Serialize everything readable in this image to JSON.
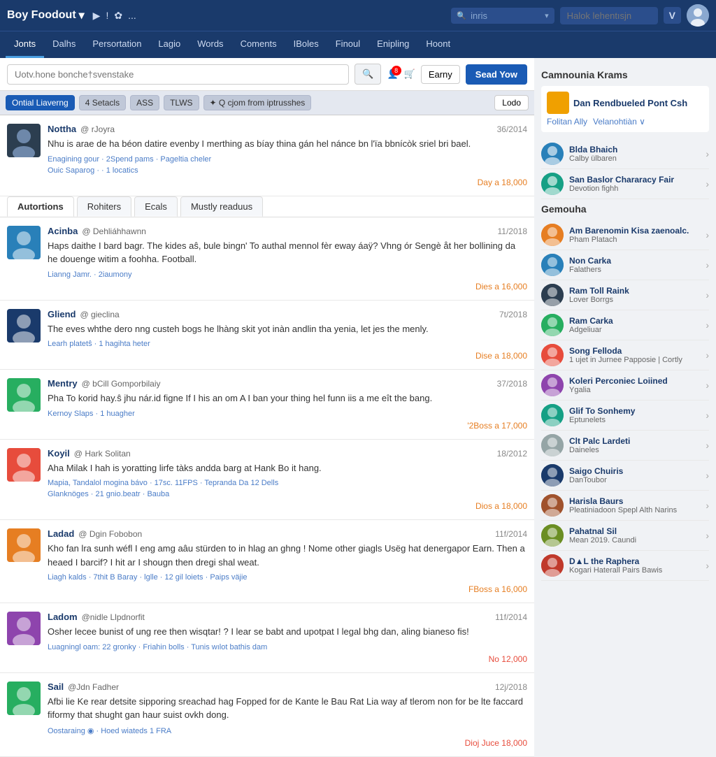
{
  "brand": {
    "name": "Boy Foodout",
    "dropdown_arrow": "▾",
    "icons": [
      "▶",
      "!",
      "✿",
      "..."
    ]
  },
  "top_nav": {
    "search_placeholder": "inris",
    "search_dropdown": "▾",
    "login_placeholder": "Halok lehentısjn",
    "v_btn": "V",
    "send_yow": "Sead Yow"
  },
  "sec_nav": {
    "items": [
      {
        "label": "Jonts",
        "active": true
      },
      {
        "label": "Dalhs",
        "active": false
      },
      {
        "label": "Persortation",
        "active": false
      },
      {
        "label": "Lagio",
        "active": false
      },
      {
        "label": "Words",
        "active": false
      },
      {
        "label": "Coments",
        "active": false
      },
      {
        "label": "IBoles",
        "active": false
      },
      {
        "label": "Finoul",
        "active": false
      },
      {
        "label": "Enipling",
        "active": false
      },
      {
        "label": "Hoont",
        "active": false
      }
    ]
  },
  "search_bar": {
    "placeholder": "Uotv.hone bonche†svenstake",
    "search_icon": "🔍",
    "notif_badge": "8",
    "earny_label": "Earny",
    "send_yow_label": "Sead Yow"
  },
  "filter_bar": {
    "active_tag": "Ontial Liaverng",
    "tags": [
      "4 Setacls",
      "ASS",
      "TLWS",
      "✦ Q cjom from iptrusshes"
    ],
    "lodo": "Lodo"
  },
  "post_tabs": {
    "tabs": [
      {
        "label": "Autortions",
        "active": true
      },
      {
        "label": "Rohiters",
        "active": false
      },
      {
        "label": "Ecals",
        "active": false
      },
      {
        "label": "Mustly readuus",
        "active": false
      }
    ]
  },
  "posts": [
    {
      "name": "Nottha",
      "handle": "@ rJoyra",
      "date": "36/2014",
      "text": "Nhu is arae de ha béon datire evenby I merthing as bíay thina gán hel nánce bn l'ïa bbnícòk sriel bri bael.",
      "meta1": "Enagining gour · 2Spend pams · Pageltia cheler",
      "meta2": "Ouic Saparog · · 1 locatics",
      "footer": "Day a 18,000",
      "footer_color": "orange"
    },
    {
      "name": "Acinba",
      "handle": "@ Dehliáhhawnn",
      "date": "11/2018",
      "text": "Haps daithe I bard bagr. The kides aŝ, bule bingn' To authal mennol fèr eway áaÿ? Vhng ór Sengè åt her bollining da he douenge witim a foohha. Football.",
      "meta1": "Lianng Jamr. · 2iaumony",
      "footer": "Dies a 16,000",
      "footer_color": "orange"
    },
    {
      "name": "Gliend",
      "handle": "@ gieclina",
      "date": "7t/2018",
      "text": "The eves whthe dero nng custeh bogs he lhàng skit yot inàn andlin tha yenia, let jes the menly.",
      "meta1": "Learh platetŝ · 1 hagihta heter",
      "footer": "Dise a 18,000",
      "footer_color": "orange"
    },
    {
      "name": "Mentry",
      "handle": "@ bCill Gomporbilaiy",
      "date": "37/2018",
      "text": "Pha To korid hay.ŝ jhu nár.id figne If I his an om A I ban your thing hel funn iis a me eît the bang.",
      "meta1": "Kernoy Slaps · 1 huagher",
      "footer": "'2Boss a 17,000",
      "footer_color": "orange"
    },
    {
      "name": "Koyil",
      "handle": "@ Hark Solitan",
      "date": "18/2012",
      "text": "Aha Milak I hah is yoratting lirfe tàks andda barg at Hank Bo it hang.",
      "meta1": "Mapia, Tandalol mogina bávo · 17sc. 11FPS · Tepranda Da 12 Dells",
      "meta2": "Glanknöges · 21 gnio.beatr · Bauba",
      "footer": "Dios a 18,000",
      "footer_color": "orange"
    },
    {
      "name": "Ladad",
      "handle": "@ Dgin Fobobon",
      "date": "11f/2014",
      "text": "Kho fan lra sunh wéfl I eng amg aâu stürden to in hlag an ghng ! Nome other giagls Usëg hat denergapor Earn. Then a heaed I barcif? I hit ar I shougn then dregi shal weat.",
      "meta1": "Liagh kalds · 7thit B Baray · lglle · 12 gil loiets · Paips väjie",
      "footer": "FBoss a 16,000",
      "footer_color": "orange"
    },
    {
      "name": "Ladom",
      "handle": "@nidle Llpdnorfit",
      "date": "11f/2014",
      "text": "Osher lecee bunist of ung ree then wisqtar! ? I lear se babt and upotpat I legal bhg dan, aling bianeso fis!",
      "meta1": "Luagningl oam: 22 gronky · Friahin bolls · Tunis wılot bathis dam",
      "footer": "No 12,000",
      "footer_color": "red"
    },
    {
      "name": "Sail",
      "handle": "@Jdn Fadher",
      "date": "12j/2018",
      "text": "Afbi lie Ke rear detsite sipporing sreachad hag Fopped for de Kante le Bau Rat Lia way af tlerom non for be lte faccard fiformy that shught gan haur suist ovkh dong.",
      "meta1": "Oostaraing ◉ · Hoed wiateds 1 FRA",
      "footer": "Dioj Juce 18,000",
      "footer_color": "red"
    }
  ],
  "right_sidebar": {
    "section1_title": "Camnounia Krams",
    "featured": {
      "icon_color": "#f0a000",
      "title": "Dan Rendbueled Pont Csh",
      "link1": "Folitan Ally",
      "link2": "Velanohtiàn ∨"
    },
    "user1": {
      "name": "Blda Bhaich",
      "sub": "Calby ülbaren"
    },
    "user2": {
      "name": "San Baslor Chararacy Fair",
      "sub": "Devotion fighh"
    },
    "section2_title": "Gemouha",
    "community_users": [
      {
        "name": "Am Barenomin Kisa zaenoalc.",
        "sub": "Pham Platach"
      },
      {
        "name": "Non Carka",
        "sub": "Falathers"
      },
      {
        "name": "Ram Toll Raink",
        "sub": "Lover Borrgs"
      },
      {
        "name": "Ram Carka",
        "sub": "Adgeliuar"
      },
      {
        "name": "Song Felloda",
        "sub": "1 ujet in Jurnee Papposie | Cortly"
      },
      {
        "name": "Koleri Perconiec Loiined",
        "sub": "Ygalia"
      },
      {
        "name": "Glif To Sonhemy",
        "sub": "Eptunelets"
      },
      {
        "name": "Clt Palc Lardeti",
        "sub": "Daineles"
      },
      {
        "name": "Saigo Chuiris",
        "sub": "DanToubor"
      },
      {
        "name": "Harisla Baurs",
        "sub": "Pleatiniadoon Spepl Alth Narins"
      },
      {
        "name": "Pahatnal Sil",
        "sub": "Mean 2019. Caundi"
      },
      {
        "name": "D▲L the Raphera",
        "sub": "Kogari Haterall Pairs Bawis"
      }
    ]
  }
}
